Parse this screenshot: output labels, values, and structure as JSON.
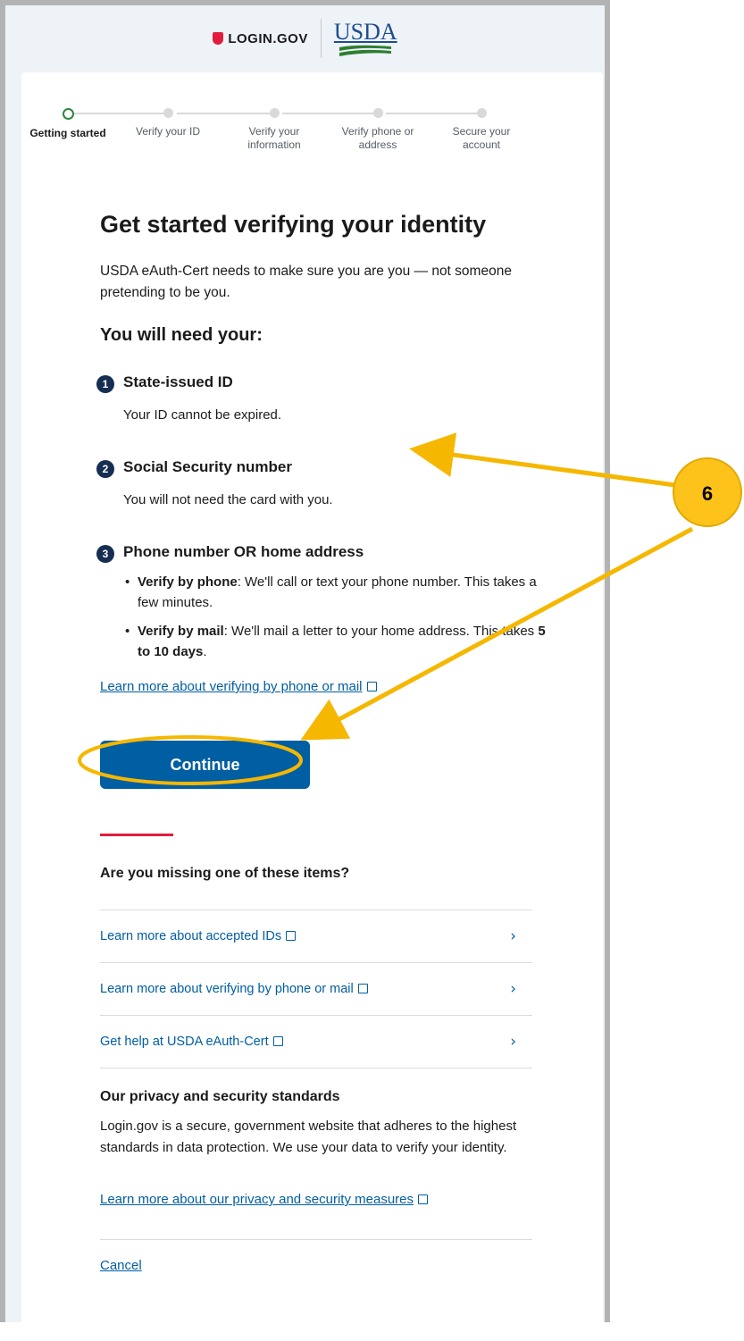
{
  "header": {
    "login_logo": "LOGIN.GOV",
    "agency_logo": "USDA"
  },
  "steps": [
    {
      "label": "Getting started",
      "active": true
    },
    {
      "label": "Verify your ID",
      "active": false
    },
    {
      "label": "Verify your information",
      "active": false
    },
    {
      "label": "Verify phone or address",
      "active": false
    },
    {
      "label": "Secure your account",
      "active": false
    }
  ],
  "main": {
    "title": "Get started verifying your identity",
    "intro": "USDA eAuth-Cert needs to make sure you are you — not someone pretending to be you.",
    "need_heading": "You will need your:",
    "requirements": [
      {
        "num": "1",
        "title": "State-issued ID",
        "desc": "Your ID cannot be expired."
      },
      {
        "num": "2",
        "title": "Social Security number",
        "desc": "You will not need the card with you."
      },
      {
        "num": "3",
        "title": "Phone number OR home address"
      }
    ],
    "bullet_phone": {
      "bold": "Verify by phone",
      "text": ": We'll call or text your phone number. This takes a few minutes."
    },
    "bullet_mail": {
      "bold": "Verify by mail",
      "text": ": We'll mail a letter to your home address. This takes ",
      "bold2": "5 to 10 days",
      "end": "."
    },
    "learn_more_link": "Learn more about verifying by phone or mail",
    "continue_label": "Continue"
  },
  "missing": {
    "heading": "Are you missing one of these items?",
    "links": [
      "Learn more about accepted IDs",
      "Learn more about verifying by phone or mail",
      "Get help at USDA eAuth-Cert"
    ]
  },
  "privacy": {
    "heading": "Our privacy and security standards",
    "text": "Login.gov is a secure, government website that adheres to the highest standards in data protection. We use your data to verify your identity.",
    "link": "Learn more about our privacy and security measures"
  },
  "cancel_label": "Cancel",
  "annotation": {
    "callout_number": "6",
    "color": "#fdc31a"
  },
  "colors": {
    "primary": "#005ea2",
    "accent": "#e21c3d",
    "step_active": "#2e8540"
  }
}
